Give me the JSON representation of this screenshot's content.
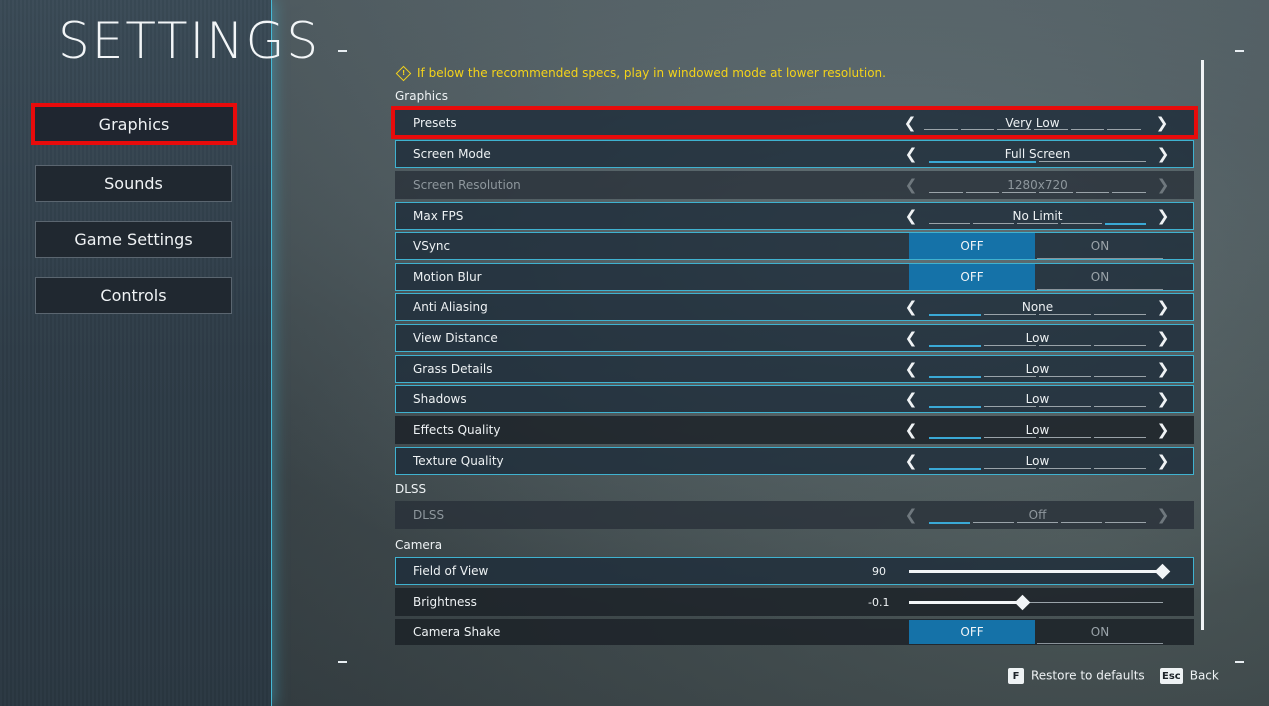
{
  "title": "SETTINGS",
  "nav": [
    {
      "label": "Graphics",
      "active": true
    },
    {
      "label": "Sounds",
      "active": false
    },
    {
      "label": "Game Settings",
      "active": false
    },
    {
      "label": "Controls",
      "active": false
    }
  ],
  "warning": "If below the recommended specs, play in windowed mode at lower resolution.",
  "sections": {
    "graphics": "Graphics",
    "dlss": "DLSS",
    "camera": "Camera"
  },
  "settings": {
    "presets": {
      "label": "Presets",
      "value": "Very Low"
    },
    "screen_mode": {
      "label": "Screen Mode",
      "value": "Full Screen"
    },
    "screen_resolution": {
      "label": "Screen Resolution",
      "value": "1280x720"
    },
    "max_fps": {
      "label": "Max FPS",
      "value": "No Limit"
    },
    "vsync": {
      "label": "VSync",
      "off": "OFF",
      "on": "ON",
      "selected": "OFF"
    },
    "motion_blur": {
      "label": "Motion Blur",
      "off": "OFF",
      "on": "ON",
      "selected": "OFF"
    },
    "anti_aliasing": {
      "label": "Anti Aliasing",
      "value": "None"
    },
    "view_distance": {
      "label": "View Distance",
      "value": "Low"
    },
    "grass_details": {
      "label": "Grass Details",
      "value": "Low"
    },
    "shadows": {
      "label": "Shadows",
      "value": "Low"
    },
    "effects_quality": {
      "label": "Effects Quality",
      "value": "Low"
    },
    "texture_quality": {
      "label": "Texture Quality",
      "value": "Low"
    },
    "dlss": {
      "label": "DLSS",
      "value": "Off"
    },
    "field_of_view": {
      "label": "Field of View",
      "value": "90",
      "fraction": 1.0
    },
    "brightness": {
      "label": "Brightness",
      "value": "-0.1",
      "fraction": 0.45
    },
    "camera_shake": {
      "label": "Camera Shake",
      "off": "OFF",
      "on": "ON",
      "selected": "OFF"
    }
  },
  "footer": {
    "restore_key": "F",
    "restore_label": "Restore to defaults",
    "back_key": "Esc",
    "back_label": "Back"
  },
  "colors": {
    "accent": "#3fb2d0",
    "highlight": "#e80b0b",
    "warning": "#f4d31a",
    "toggle_active": "#1572a8"
  }
}
